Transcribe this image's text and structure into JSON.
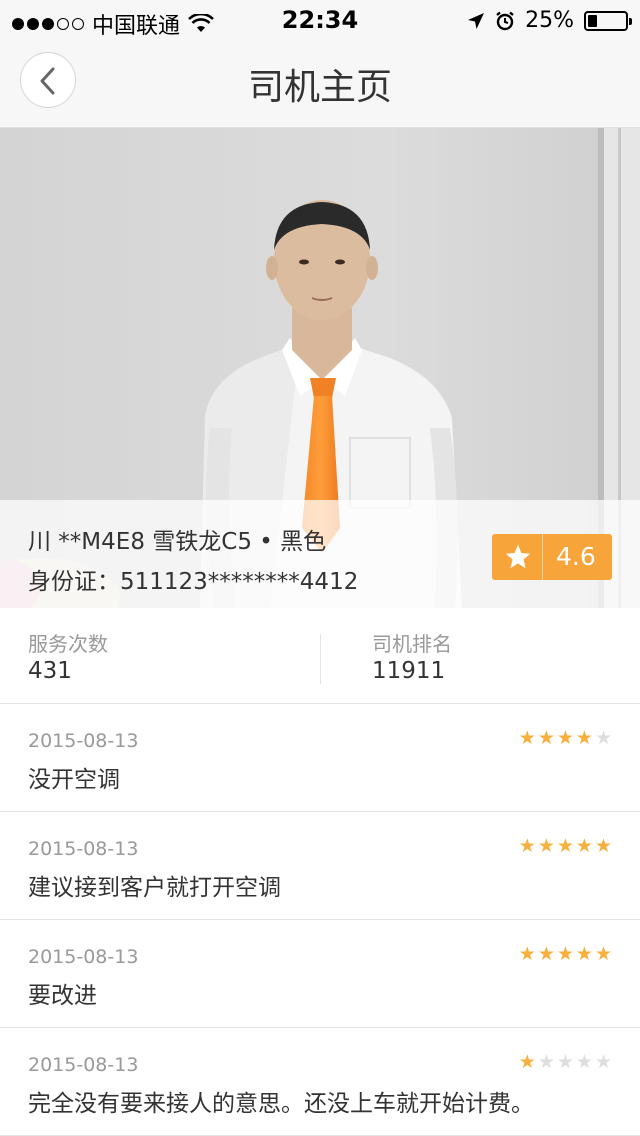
{
  "status_bar": {
    "carrier": "中国联通",
    "time": "22:34",
    "battery": "25%",
    "battery_level": 0.25,
    "signal_bars": 3,
    "signal_max": 5
  },
  "navbar": {
    "title": "司机主页",
    "back_icon": "chevron-left-icon"
  },
  "driver": {
    "plate_line": "川 **M4E8 雪铁龙C5 • 黑色",
    "id_line": "身份证：511123********4412",
    "rating": "4.6",
    "rating_icon": "star-icon",
    "accent_color": "#f7a53a"
  },
  "stats": {
    "service_count_label": "服务次数",
    "service_count": "431",
    "rank_label": "司机排名",
    "rank": "11911"
  },
  "reviews": [
    {
      "date": "2015-08-13",
      "text": "没开空调",
      "stars": 4
    },
    {
      "date": "2015-08-13",
      "text": "建议接到客户就打开空调",
      "stars": 5
    },
    {
      "date": "2015-08-13",
      "text": "要改进",
      "stars": 5
    },
    {
      "date": "2015-08-13",
      "text": "完全没有要来接人的意思。还没上车就开始计费。",
      "stars": 1
    }
  ]
}
